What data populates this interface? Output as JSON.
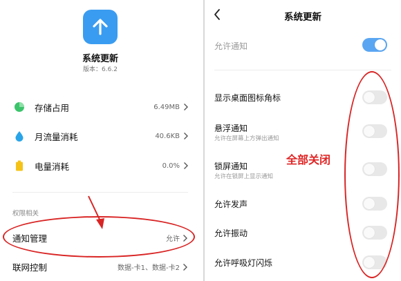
{
  "left": {
    "app": {
      "name": "系统更新",
      "version": "版本：6.6.2",
      "icon": "arrow-up-icon",
      "icon_color": "#3a9cf0"
    },
    "stats": [
      {
        "label": "存储占用",
        "value": "6.49MB",
        "icon": "pie-chart-icon",
        "icon_color": "#3cc46b"
      },
      {
        "label": "月流量消耗",
        "value": "40.6KB",
        "icon": "water-drop-icon",
        "icon_color": "#2aa4e8"
      },
      {
        "label": "电量消耗",
        "value": "0.0%",
        "icon": "battery-icon",
        "icon_color": "#f5c318"
      }
    ],
    "section_label": "权限相关",
    "permissions": [
      {
        "label": "通知管理",
        "value": "允许"
      },
      {
        "label": "联网控制",
        "value": "数据-卡1、数据-卡2"
      }
    ]
  },
  "right": {
    "title": "系统更新",
    "allow_notifications": {
      "label": "允许通知",
      "on": true
    },
    "settings": [
      {
        "label": "显示桌面图标角标",
        "sub": "",
        "on": false
      },
      {
        "label": "悬浮通知",
        "sub": "允许在屏幕上方弹出通知",
        "on": false
      },
      {
        "label": "锁屏通知",
        "sub": "允许在锁屏上显示通知",
        "on": false
      },
      {
        "label": "允许发声",
        "sub": "",
        "on": false
      },
      {
        "label": "允许振动",
        "sub": "",
        "on": false
      },
      {
        "label": "允许呼吸灯闪烁",
        "sub": "",
        "on": false
      }
    ],
    "annotation": "全部关闭"
  },
  "colors": {
    "accent": "#3a9cf0",
    "toggle_on": "#5aa6f2",
    "annotation_red": "#d92424"
  }
}
